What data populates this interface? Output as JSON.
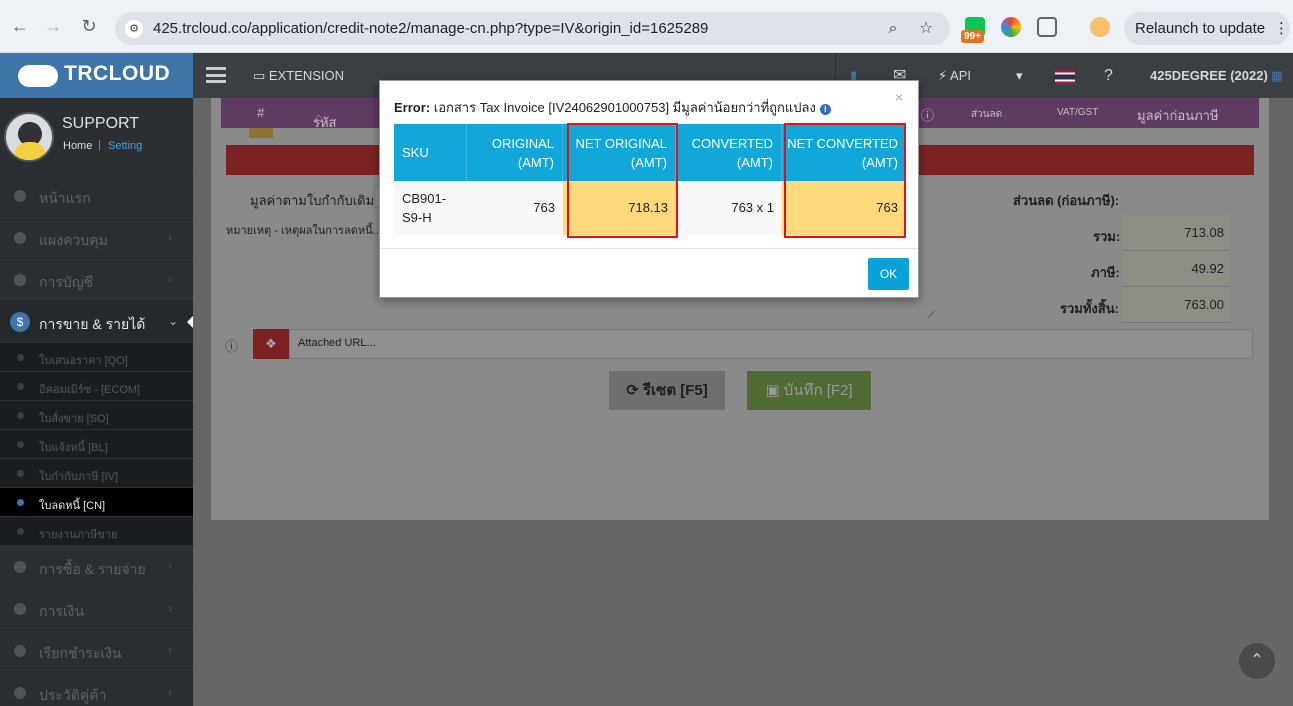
{
  "browser": {
    "url": "425.trcloud.co/application/credit-note2/manage-cn.php?type=IV&origin_id=1625289",
    "badge_count": "99+",
    "relaunch_label": "Relaunch to update"
  },
  "header": {
    "logo_text": "TRCLOUD",
    "extension_label": "EXTENSION",
    "api_label": "API",
    "company": "425DEGREE (2022)"
  },
  "sidebar": {
    "user": "SUPPORT",
    "home_link": "Home",
    "setting_link": "Setting",
    "items": [
      {
        "label": "หน้าแรก"
      },
      {
        "label": "แผงควบคุม"
      },
      {
        "label": "การบัญชี"
      },
      {
        "label": "การขาย & รายได้"
      },
      {
        "label": "การซื้อ & รายจ่าย"
      },
      {
        "label": "การเงิน"
      },
      {
        "label": "เรียกชำระเงิน"
      },
      {
        "label": "ประวัติคู่ค้า"
      }
    ],
    "sub_items": [
      {
        "label": "ใบเสนอราคา [QO]"
      },
      {
        "label": "อีคอมเมิร์ซ - [ECOM]"
      },
      {
        "label": "ใบสั่งขาย [SO]"
      },
      {
        "label": "ใบแจ้งหนี้ [BL]"
      },
      {
        "label": "ใบกำกับภาษี [IV]"
      },
      {
        "label": "ใบลดหนี้ [CN]"
      },
      {
        "label": "รายงานภาษีขาย"
      }
    ]
  },
  "background": {
    "col_hash": "#",
    "col_code": "รหัส",
    "col_discount": "ส่วนลด",
    "col_vat": "VAT/GST",
    "col_pre_tax": "มูลค่าก่อนภาษี",
    "original_value_label": "มูลค่าตามใบกำกับเดิม:",
    "note_label": "หมายเหตุ - เหตุผลในการลดหนี้...",
    "discount_label": "ส่วนลด (ก่อนภาษี):",
    "total_label": "รวม:",
    "total_value": "713.08",
    "tax_label": "ภาษี:",
    "tax_value": "49.92",
    "grand_total_label": "รวมทั้งสิ้น:",
    "grand_total_value": "763.00",
    "attached_url_placeholder": "Attached URL...",
    "reset_label": "รีเซต [F5]",
    "save_label": "บันทึก [F2]"
  },
  "modal": {
    "title_prefix": "Error:",
    "title_text": "เอกสาร Tax Invoice [IV24062901000753] มีมูลค่าน้อยกว่าที่ถูกแปลง",
    "close": "×",
    "headers": {
      "sku": "SKU",
      "original": [
        "ORIGINAL",
        "(AMT)"
      ],
      "net_original": [
        "NET ORIGINAL",
        "(AMT)"
      ],
      "converted": [
        "CONVERTED",
        "(AMT)"
      ],
      "net_converted": [
        "NET CONVERTED",
        "(AMT)"
      ]
    },
    "row": {
      "sku": [
        "CB901-",
        "S9-H"
      ],
      "original": "763",
      "net_original": "718.13",
      "converted": "763 x 1",
      "net_converted": "763"
    },
    "ok_label": "OK"
  },
  "colors": {
    "table_header": "#11a8d9",
    "highlight": "#ffd97a",
    "highlight_border": "#e0111a",
    "ok_button": "#0aa0d8"
  }
}
